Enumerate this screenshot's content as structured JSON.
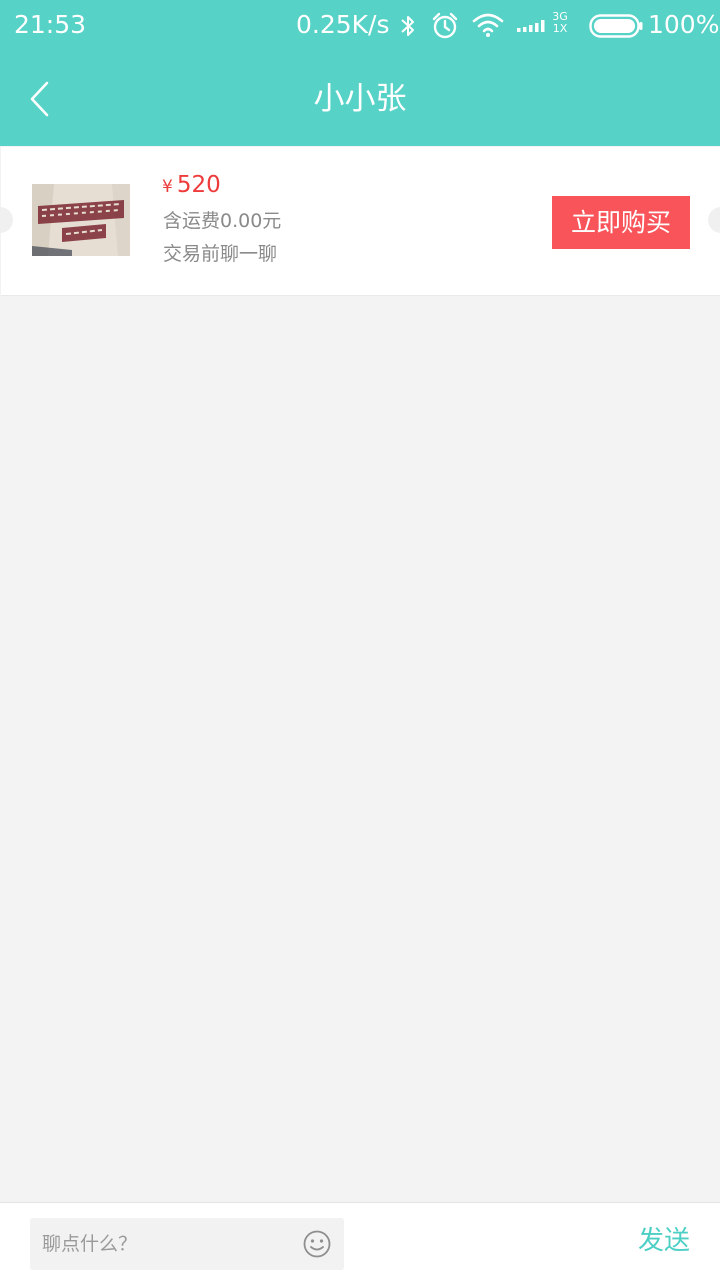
{
  "status_bar": {
    "time": "21:53",
    "network_speed": "0.25K/s",
    "network_type_top": "3G",
    "network_type_bottom": "1X",
    "battery": "100%",
    "icons": [
      "bluetooth-icon",
      "alarm-icon",
      "wifi-icon",
      "signal-icon",
      "battery-icon"
    ]
  },
  "header": {
    "title": "小小张",
    "back_icon": "chevron-left-icon"
  },
  "product": {
    "price_symbol": "¥",
    "price": "520",
    "shipping": "含运费0.00元",
    "chat_hint": "交易前聊一聊",
    "buy_label": "立即购买"
  },
  "input_bar": {
    "placeholder": "聊点什么？",
    "emoji_icon": "smiley-icon",
    "send_label": "发送"
  },
  "colors": {
    "brand": "#57d2c7",
    "price": "#ee3b3b",
    "buy_button": "#f8545a",
    "send_text": "#4ccfc4",
    "background": "#f3f3f3"
  }
}
